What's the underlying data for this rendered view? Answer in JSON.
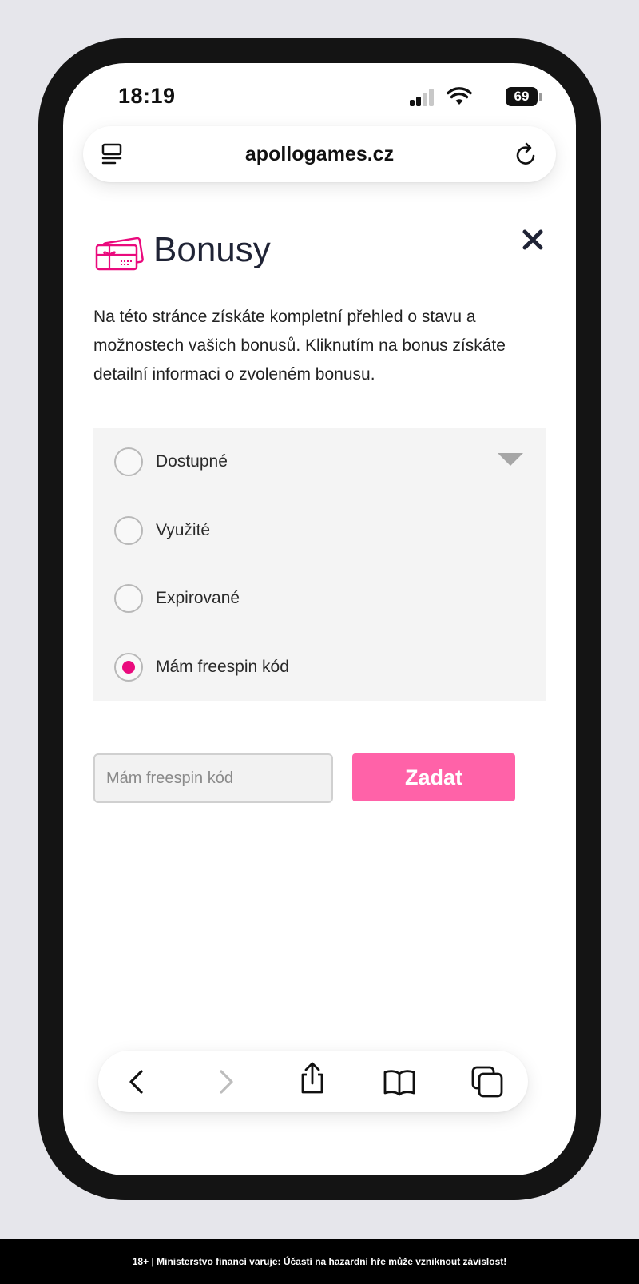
{
  "status_bar": {
    "time": "18:19",
    "battery": "69"
  },
  "browser": {
    "url": "apollogames.cz",
    "icons": [
      "reader-icon",
      "reload-icon"
    ]
  },
  "page": {
    "title": "Bonusy",
    "description": "Na této stránce získáte kompletní přehled o stavu a možnostech vašich bonusů. Kliknutím na bonus získáte detailní informaci o zvoleném bonusu.",
    "filters": [
      {
        "label": "Dostupné",
        "selected": false
      },
      {
        "label": "Využité",
        "selected": false
      },
      {
        "label": "Expirované",
        "selected": false
      },
      {
        "label": "Mám freespin kód",
        "selected": true
      }
    ],
    "code_input": {
      "placeholder": "Mám freespin kód",
      "value": ""
    },
    "submit_label": "Zadat"
  },
  "toolbar": {
    "items": [
      "back-icon",
      "forward-icon",
      "share-icon",
      "bookmarks-icon",
      "tabs-icon"
    ]
  },
  "footer": {
    "warning": "18+ | Ministerstvo financí varuje: Účastí na hazardní hře může vzniknout závislost!"
  },
  "colors": {
    "accent": "#ea0a7d",
    "button": "#ff62a8",
    "panel": "#f4f4f4",
    "frame": "#141414"
  }
}
